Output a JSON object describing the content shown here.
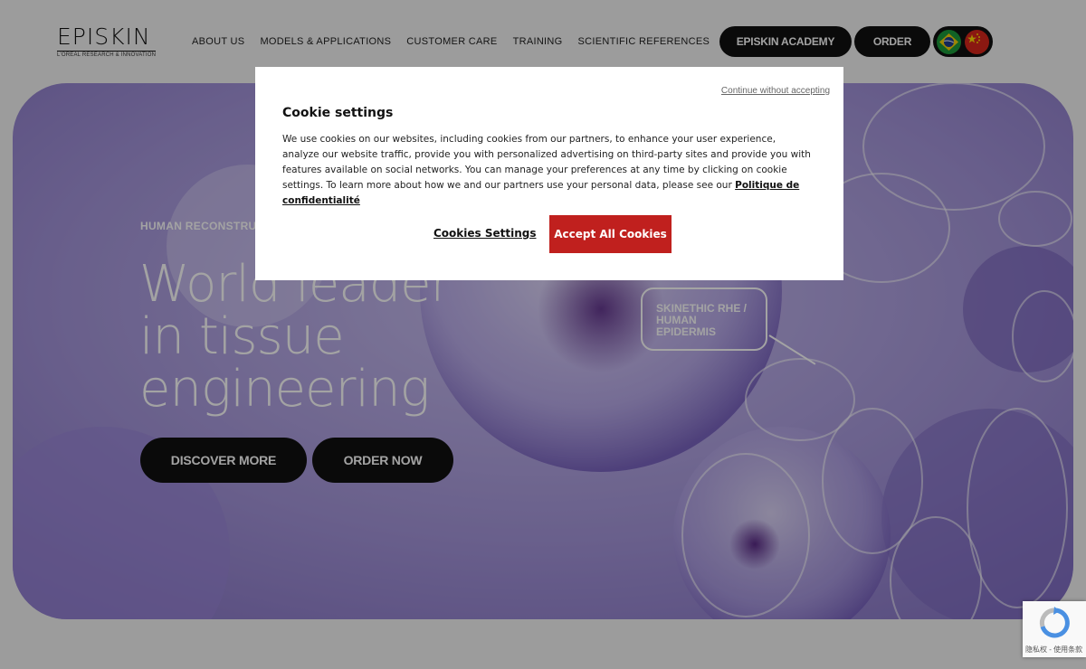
{
  "logo": {
    "main": "EPISKIN",
    "sub": "L'ORÉAL RESEARCH & INNOVATION"
  },
  "nav": [
    "ABOUT US",
    "MODELS & APPLICATIONS",
    "CUSTOMER CARE",
    "TRAINING",
    "SCIENTIFIC REFERENCES"
  ],
  "header_buttons": {
    "academy": "EPISKIN ACADEMY",
    "order": "ORDER"
  },
  "flags": [
    "brazil-flag-icon",
    "china-flag-icon"
  ],
  "hero": {
    "eyebrow": "HUMAN RECONSTRUC",
    "headline": [
      "World leader",
      "in tissue",
      "engineering"
    ],
    "discover": "DISCOVER MORE",
    "order_now": "ORDER NOW",
    "tag": [
      "SKINETHIC RHE /",
      "HUMAN",
      "EPIDERMIS"
    ]
  },
  "cookie": {
    "continue": "Continue without accepting",
    "title": "Cookie settings",
    "body": "We use cookies on our websites, including cookies from our partners, to enhance your user experience, analyze our website traffic, provide you with personalized advertising on third-party sites and provide you with features available on social networks. You can manage your preferences at any time by clicking on cookie settings. To learn more about how we and our partners use your personal data, please see our",
    "policy_link": "Politique de confidentialité",
    "settings_button": "Cookies Settings",
    "accept_button": "Accept All Cookies"
  },
  "recaptcha": {
    "text": "隐私权 - 使用条款"
  },
  "colors": {
    "accent": "#c0201e",
    "dark": "#111111",
    "hero": "#a89ad6"
  }
}
